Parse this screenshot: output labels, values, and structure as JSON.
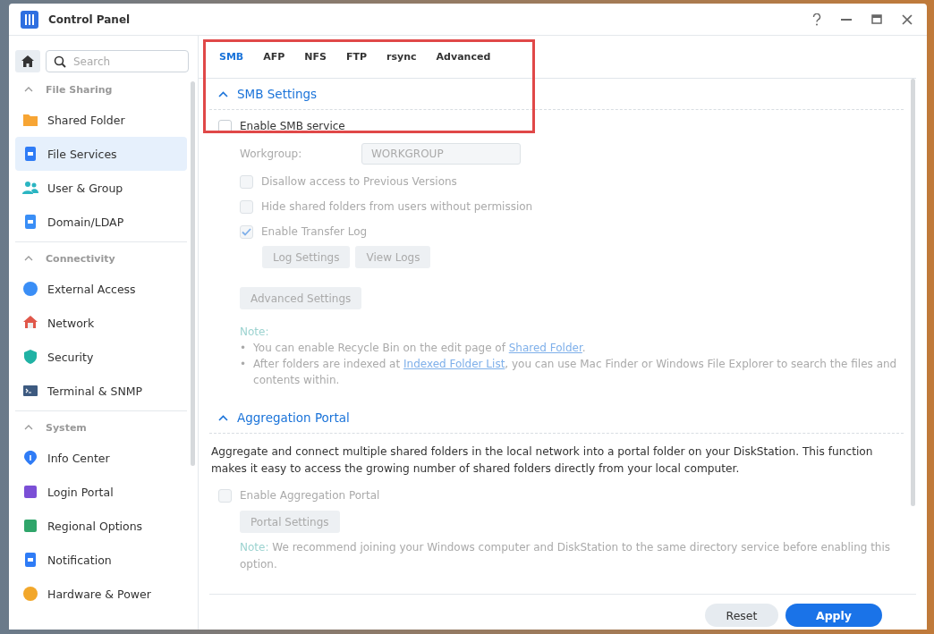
{
  "window": {
    "title": "Control Panel"
  },
  "sidebar": {
    "search": {
      "placeholder": "Search"
    },
    "sections": [
      {
        "title": "File Sharing",
        "expanded": true,
        "items": [
          {
            "label": "Shared Folder",
            "selected": false
          },
          {
            "label": "File Services",
            "selected": true
          },
          {
            "label": "User & Group",
            "selected": false
          },
          {
            "label": "Domain/LDAP",
            "selected": false
          }
        ]
      },
      {
        "title": "Connectivity",
        "expanded": true,
        "items": [
          {
            "label": "External Access",
            "selected": false
          },
          {
            "label": "Network",
            "selected": false
          },
          {
            "label": "Security",
            "selected": false
          },
          {
            "label": "Terminal & SNMP",
            "selected": false
          }
        ]
      },
      {
        "title": "System",
        "expanded": true,
        "items": [
          {
            "label": "Info Center",
            "selected": false
          },
          {
            "label": "Login Portal",
            "selected": false
          },
          {
            "label": "Regional Options",
            "selected": false
          },
          {
            "label": "Notification",
            "selected": false
          },
          {
            "label": "Hardware & Power",
            "selected": false
          }
        ]
      }
    ]
  },
  "tabs": [
    {
      "label": "SMB",
      "selected": true
    },
    {
      "label": "AFP",
      "selected": false
    },
    {
      "label": "NFS",
      "selected": false
    },
    {
      "label": "FTP",
      "selected": false
    },
    {
      "label": "rsync",
      "selected": false
    },
    {
      "label": "Advanced",
      "selected": false
    }
  ],
  "smb": {
    "title": "SMB Settings",
    "expanded": true,
    "enable": {
      "label": "Enable SMB service",
      "checked": false
    },
    "workgroup": {
      "label": "Workgroup:",
      "value": "WORKGROUP",
      "disabled": true
    },
    "options": [
      {
        "label": "Disallow access to Previous Versions",
        "checked": false,
        "disabled": true
      },
      {
        "label": "Hide shared folders from users without permission",
        "checked": false,
        "disabled": true
      },
      {
        "label": "Enable Transfer Log",
        "checked": true,
        "disabled": true
      }
    ],
    "log_buttons": [
      {
        "label": "Log Settings",
        "disabled": true
      },
      {
        "label": "View Logs",
        "disabled": true
      }
    ],
    "advanced_button": {
      "label": "Advanced Settings",
      "disabled": true
    },
    "note": {
      "title": "Note:",
      "items": [
        {
          "marker": "•",
          "before": "You can enable Recycle Bin on the edit page of ",
          "link": "Shared Folder",
          "after": "."
        },
        {
          "marker": "•",
          "before": "After folders are indexed at ",
          "link": "Indexed Folder List",
          "after": ", you can use Mac Finder or Windows File Explorer to search the files and contents within."
        }
      ]
    }
  },
  "aggregation": {
    "title": "Aggregation Portal",
    "expanded": true,
    "description": "Aggregate and connect multiple shared folders in the local network into a portal folder on your DiskStation. This function makes it easy to access the growing number of shared folders directly from your local computer.",
    "enable": {
      "label": "Enable Aggregation Portal",
      "checked": false,
      "disabled": true
    },
    "button": {
      "label": "Portal Settings",
      "disabled": true
    },
    "note": {
      "title": "Note:",
      "text": "We recommend joining your Windows computer and DiskStation to the same directory service before enabling this option."
    }
  },
  "footer": {
    "buttons": [
      {
        "label": "Reset",
        "kind": "secondary"
      },
      {
        "label": "Apply",
        "kind": "primary"
      }
    ]
  }
}
